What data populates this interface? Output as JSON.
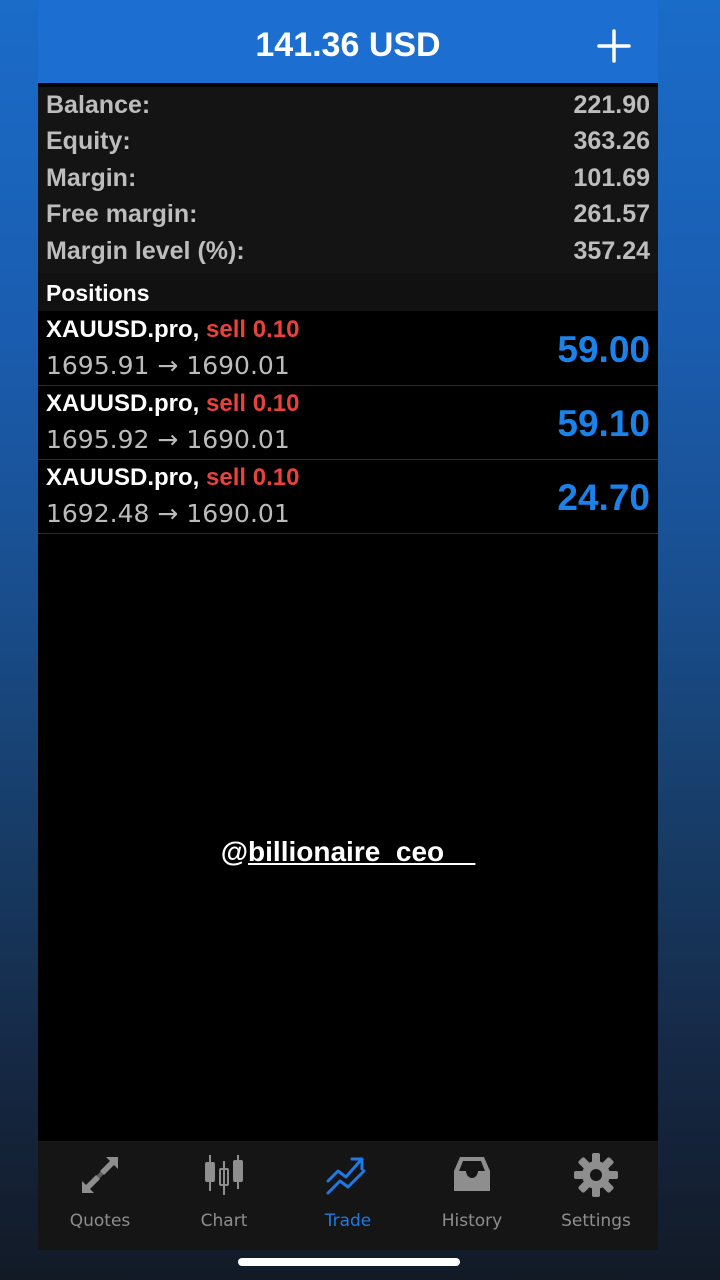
{
  "header": {
    "title": "141.36 USD",
    "add_icon": "plus-icon"
  },
  "summary": [
    {
      "label": "Balance:",
      "value": "221.90"
    },
    {
      "label": "Equity:",
      "value": "363.26"
    },
    {
      "label": "Margin:",
      "value": "101.69"
    },
    {
      "label": "Free margin:",
      "value": "261.57"
    },
    {
      "label": "Margin level (%):",
      "value": "357.24"
    }
  ],
  "positions": {
    "title": "Positions",
    "items": [
      {
        "symbol": "XAUUSD.pro,",
        "side": "sell 0.10",
        "open": "1695.91",
        "arrow": "→",
        "current": "1690.01",
        "profit": "59.00"
      },
      {
        "symbol": "XAUUSD.pro,",
        "side": "sell 0.10",
        "open": "1695.92",
        "arrow": "→",
        "current": "1690.01",
        "profit": "59.10"
      },
      {
        "symbol": "XAUUSD.pro,",
        "side": "sell 0.10",
        "open": "1692.48",
        "arrow": "→",
        "current": "1690.01",
        "profit": "24.70"
      }
    ]
  },
  "watermark": {
    "at": "@",
    "handle": "billionaire_ceo__"
  },
  "tabs": [
    {
      "label": "Quotes",
      "icon": "quotes-arrows-icon",
      "active": false
    },
    {
      "label": "Chart",
      "icon": "candlestick-chart-icon",
      "active": false
    },
    {
      "label": "Trade",
      "icon": "trade-trend-icon",
      "active": true
    },
    {
      "label": "History",
      "icon": "inbox-tray-icon",
      "active": false
    },
    {
      "label": "Settings",
      "icon": "gear-icon",
      "active": false
    }
  ],
  "colors": {
    "accent": "#1c6fd1",
    "profit": "#1b82ea",
    "sell": "#e8423b",
    "tab_inactive": "#8e8e8e",
    "tab_active": "#1f7ae6"
  }
}
